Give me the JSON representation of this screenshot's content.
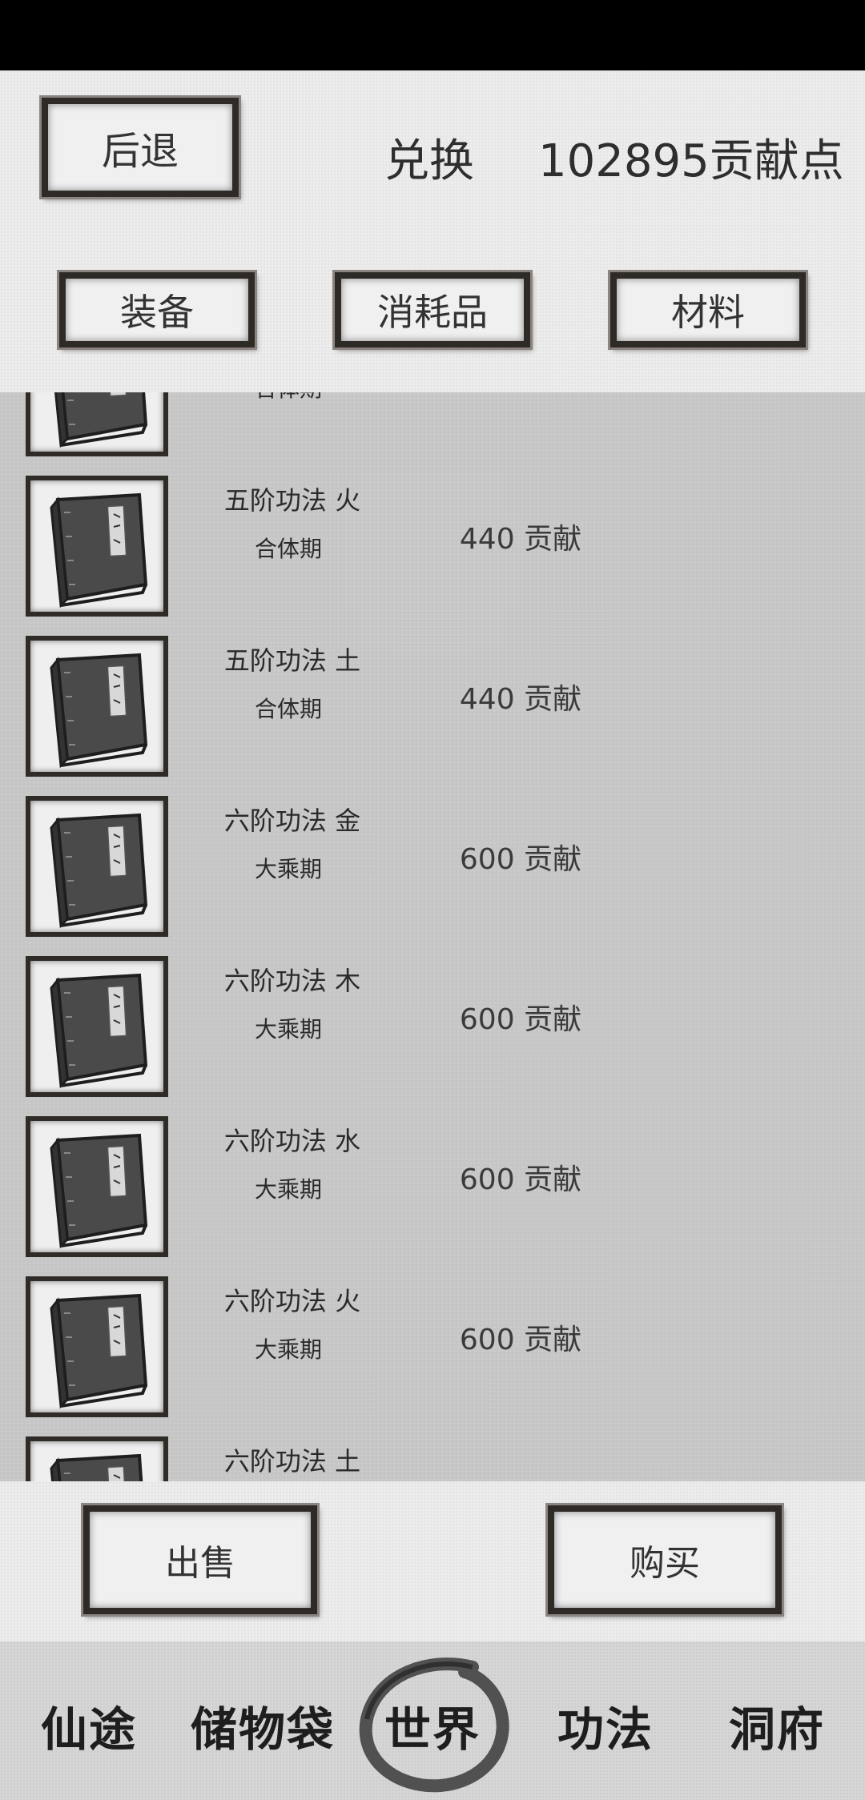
{
  "header": {
    "back_label": "后退",
    "title": "兑换",
    "points": "102895贡献点"
  },
  "tabs": [
    {
      "label": "装备"
    },
    {
      "label": "消耗品"
    },
    {
      "label": "材料"
    }
  ],
  "items": [
    {
      "name": "",
      "realm": "合体期",
      "price": ""
    },
    {
      "name": "五阶功法 火",
      "realm": "合体期",
      "price": "440 贡献"
    },
    {
      "name": "五阶功法 土",
      "realm": "合体期",
      "price": "440 贡献"
    },
    {
      "name": "六阶功法 金",
      "realm": "大乘期",
      "price": "600 贡献"
    },
    {
      "name": "六阶功法 木",
      "realm": "大乘期",
      "price": "600 贡献"
    },
    {
      "name": "六阶功法 水",
      "realm": "大乘期",
      "price": "600 贡献"
    },
    {
      "name": "六阶功法 火",
      "realm": "大乘期",
      "price": "600 贡献"
    },
    {
      "name": "六阶功法 土",
      "realm": "",
      "price": ""
    }
  ],
  "actions": {
    "sell_label": "出售",
    "buy_label": "购买"
  },
  "nav": [
    {
      "label": "仙途"
    },
    {
      "label": "储物袋"
    },
    {
      "label": "世界"
    },
    {
      "label": "功法"
    },
    {
      "label": "洞府"
    }
  ]
}
